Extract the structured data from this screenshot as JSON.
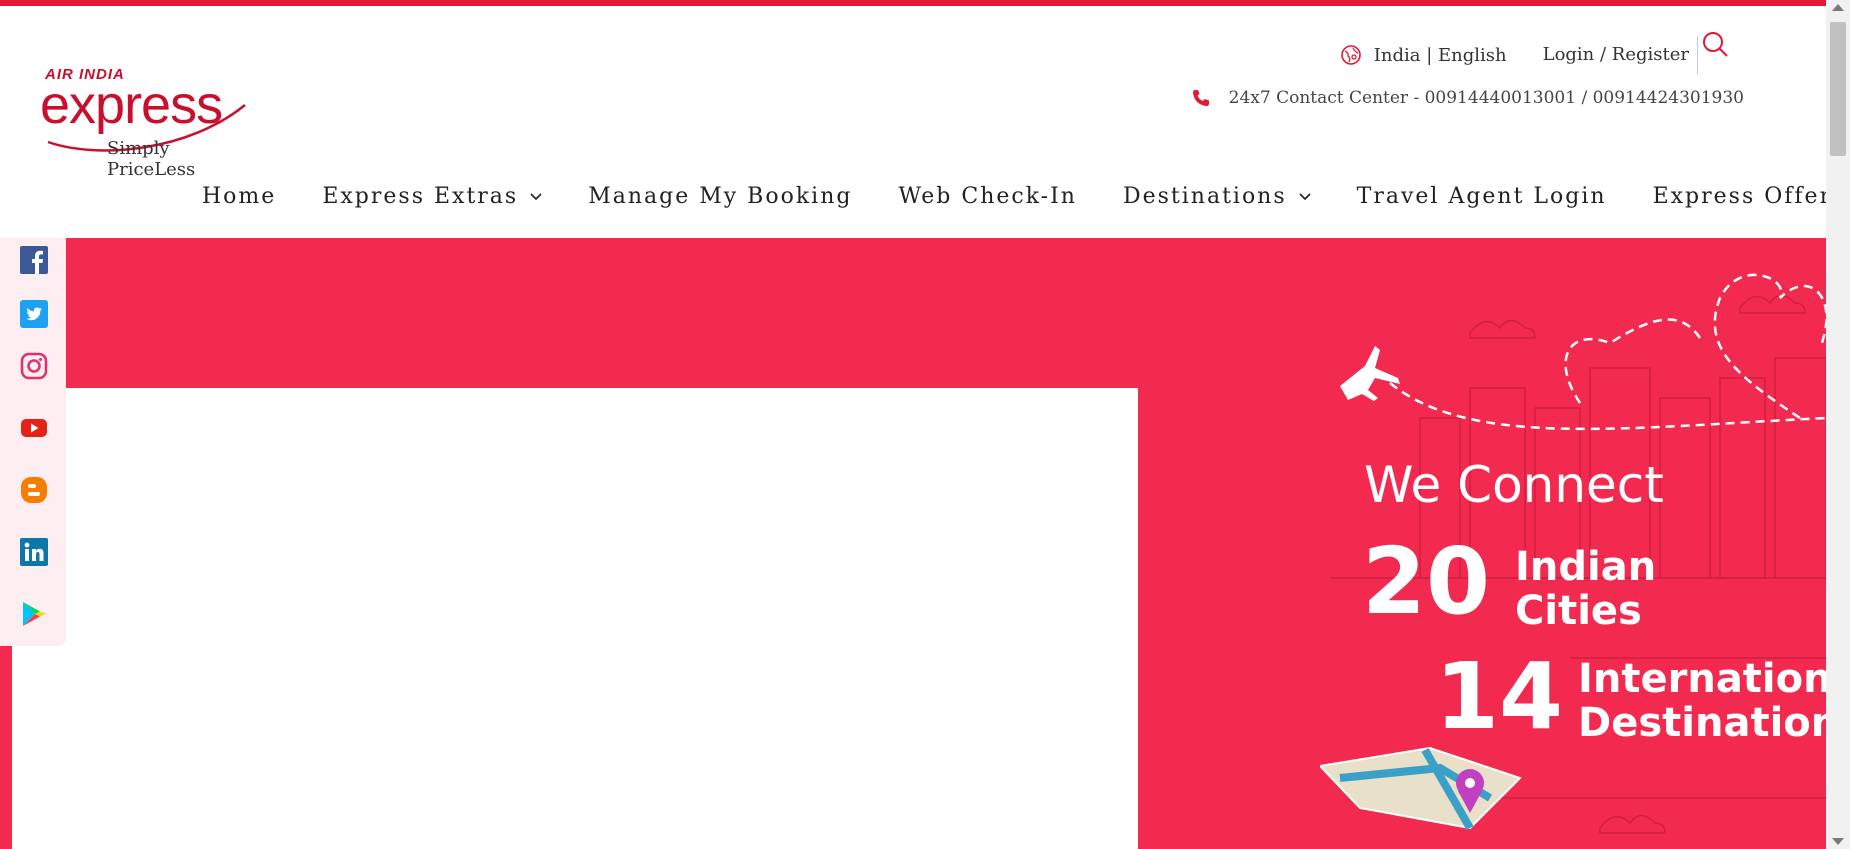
{
  "brand": {
    "logo_top": "AIR INDIA",
    "logo_main": "express",
    "tagline": "Simply PriceLess"
  },
  "utility": {
    "region": "India | English",
    "login": "Login / Register",
    "contact": "24x7 Contact Center - 00914440013001 / 00914424301930"
  },
  "nav": {
    "items": [
      {
        "label": "Home",
        "dropdown": false
      },
      {
        "label": "Express Extras",
        "dropdown": true
      },
      {
        "label": "Manage My Booking",
        "dropdown": false
      },
      {
        "label": "Web Check-In",
        "dropdown": false
      },
      {
        "label": "Destinations",
        "dropdown": true
      },
      {
        "label": "Travel Agent Login",
        "dropdown": false
      },
      {
        "label": "Express Offers",
        "dropdown": false
      }
    ]
  },
  "social": [
    "facebook-icon",
    "twitter-icon",
    "instagram-icon",
    "youtube-icon",
    "blogger-icon",
    "linkedin-icon",
    "google-play-icon"
  ],
  "promo": {
    "headline": "We Connect",
    "num1": "20",
    "line1a": "Indian",
    "line1b": "Cities",
    "num2": "14",
    "line2a": "International",
    "line2b": "Destinations"
  },
  "colors": {
    "brand_red": "#e31837",
    "hero_bg": "#f32a50"
  }
}
